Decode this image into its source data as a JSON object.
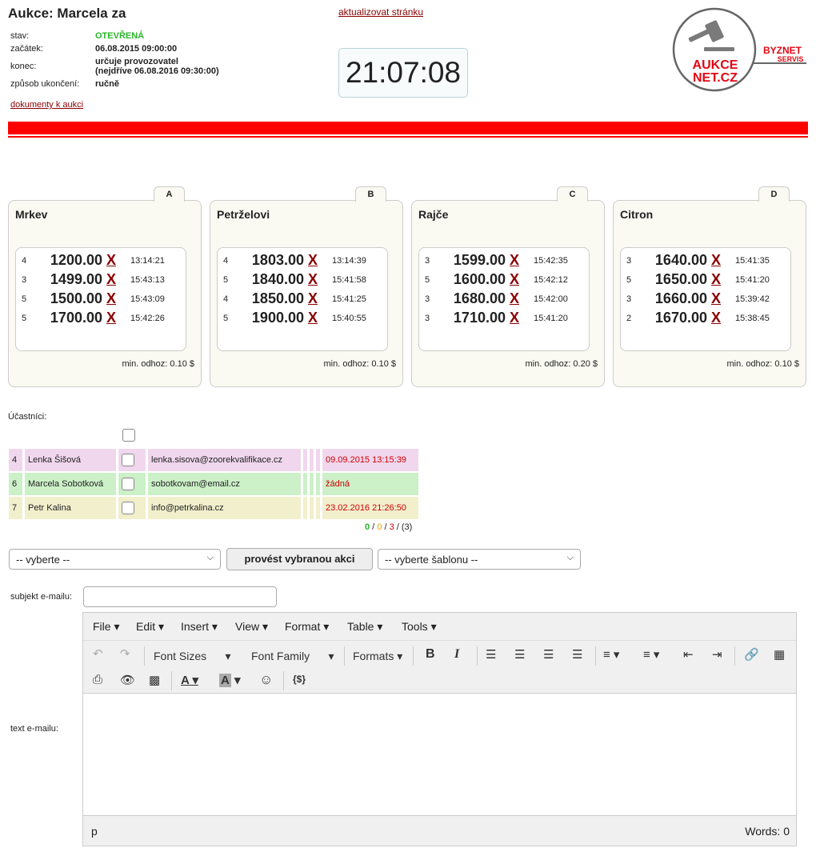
{
  "header": {
    "title": "Aukce: Marcela za",
    "info": [
      {
        "label": "stav:",
        "value": "OTEVŘENÁ"
      },
      {
        "label": "začátek:",
        "value": "06.08.2015 09:00:00"
      },
      {
        "label": "konec:",
        "value": "určuje provozovatel",
        "value2": "(nejdříve 06.08.2016 09:30:00)"
      },
      {
        "label": "způsob ukončení:",
        "value": "ručně"
      }
    ],
    "docs_link": "dokumenty k aukci",
    "refresh_link": "aktualizovat stránku",
    "clock": "21:07:08"
  },
  "logo": {
    "line1": "AUKCE",
    "line2": "NET.CZ",
    "brand1": "BYZNET",
    "brand2": "SERVIS",
    "color": "#e30613"
  },
  "cards": [
    {
      "tab": "A",
      "title": "Mrkev",
      "min": "min. odhoz: 0.10 $",
      "bids": [
        {
          "n": "4",
          "amt": "1200.00",
          "x": "X",
          "t": "13:14:21"
        },
        {
          "n": "3",
          "amt": "1499.00",
          "x": "X",
          "t": "15:43:13"
        },
        {
          "n": "5",
          "amt": "1500.00",
          "x": "X",
          "t": "15:43:09"
        },
        {
          "n": "5",
          "amt": "1700.00",
          "x": "X",
          "t": "15:42:26"
        }
      ]
    },
    {
      "tab": "B",
      "title": "Petrželovi",
      "min": "min. odhoz: 0.10 $",
      "bids": [
        {
          "n": "4",
          "amt": "1803.00",
          "x": "X",
          "t": "13:14:39"
        },
        {
          "n": "5",
          "amt": "1840.00",
          "x": "X",
          "t": "15:41:58"
        },
        {
          "n": "4",
          "amt": "1850.00",
          "x": "X",
          "t": "15:41:25"
        },
        {
          "n": "5",
          "amt": "1900.00",
          "x": "X",
          "t": "15:40:55"
        }
      ]
    },
    {
      "tab": "C",
      "title": "Rajče",
      "min": "min. odhoz: 0.20 $",
      "bids": [
        {
          "n": "3",
          "amt": "1599.00",
          "x": "X",
          "t": "15:42:35"
        },
        {
          "n": "5",
          "amt": "1600.00",
          "x": "X",
          "t": "15:42:12"
        },
        {
          "n": "3",
          "amt": "1680.00",
          "x": "X",
          "t": "15:42:00"
        },
        {
          "n": "3",
          "amt": "1710.00",
          "x": "X",
          "t": "15:41:20"
        }
      ]
    },
    {
      "tab": "D",
      "title": "Citron",
      "min": "min. odhoz: 0.10 $",
      "bids": [
        {
          "n": "3",
          "amt": "1640.00",
          "x": "X",
          "t": "15:41:35"
        },
        {
          "n": "5",
          "amt": "1650.00",
          "x": "X",
          "t": "15:41:20"
        },
        {
          "n": "3",
          "amt": "1660.00",
          "x": "X",
          "t": "15:39:42"
        },
        {
          "n": "2",
          "amt": "1670.00",
          "x": "X",
          "t": "15:38:45"
        }
      ]
    }
  ],
  "participants": {
    "label": "Účastníci:",
    "rows": [
      {
        "id": "4",
        "name": "Lenka Šišová",
        "email": "lenka.sisova@zoorekvalifikace.cz",
        "date": "09.09.2015 13:15:39"
      },
      {
        "id": "6",
        "name": "Marcela Sobotková",
        "email": "sobotkovam@email.cz",
        "date": "žádná"
      },
      {
        "id": "7",
        "name": "Petr Kalina",
        "email": "info@petrkalina.cz",
        "date": "23.02.2016 21:26:50"
      }
    ],
    "counts": {
      "green": "0",
      "orange": "0",
      "red": "3",
      "total": "(3)"
    }
  },
  "actions": {
    "select1": "-- vyberte --",
    "button": "provést vybranou akci",
    "select2": "-- vyberte šablonu --"
  },
  "email": {
    "subject_label": "subjekt e-mailu:",
    "subject_value": "",
    "text_label": "text e-mailu:"
  },
  "editor": {
    "menu": [
      "File",
      "Edit",
      "Insert",
      "View",
      "Format",
      "Table",
      "Tools"
    ],
    "font_sizes": "Font Sizes",
    "font_family": "Font Family",
    "formats": "Formats",
    "path": "p",
    "words": "Words: 0"
  }
}
